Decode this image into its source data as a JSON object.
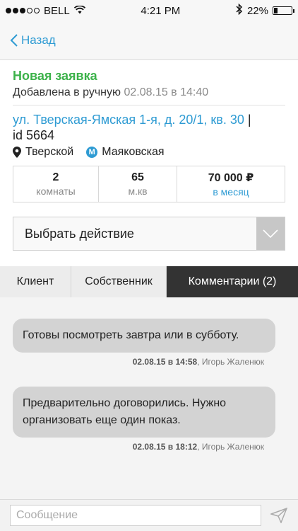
{
  "status_bar": {
    "signal_dots_filled": 3,
    "signal_dots_total": 5,
    "carrier": "BELL",
    "time": "4:21 PM",
    "battery": "22%",
    "battery_level": 0.22
  },
  "nav": {
    "back_label": "Назад"
  },
  "lead": {
    "status": "Новая заявка",
    "added_prefix": "Добавлена в ручную",
    "added_datetime": "02.08.15 в 14:40",
    "address": "ул. Тверская-Ямская 1-я, д. 20/1, кв. 30",
    "address_separator": "|",
    "id": "id 5664",
    "district": "Тверской",
    "metro_icon_letter": "М",
    "metro": "Маяковская"
  },
  "stats": [
    {
      "value": "2",
      "label": "комнаты"
    },
    {
      "value": "65",
      "label": "м.кв"
    },
    {
      "value": "70 000 ₽",
      "label": "в месяц"
    }
  ],
  "action_select": {
    "value": "Выбрать действие"
  },
  "tabs": [
    {
      "label": "Клиент"
    },
    {
      "label": "Собственник"
    },
    {
      "label": "Комментарии (2)"
    }
  ],
  "comments": [
    {
      "text": "Готовы посмотреть завтра или в субботу.",
      "datetime": "02.08.15 в 14:58",
      "author": "Игорь Жаленюк"
    },
    {
      "text": "Предварительно договорились. Нужно организовать еще один показ.",
      "datetime": "02.08.15 в 18:12",
      "author": "Игорь Жаленюк"
    }
  ],
  "composer": {
    "placeholder": "Сообщение"
  },
  "colors": {
    "accent": "#2e9bd3",
    "status_green": "#3cb24a",
    "tab_active": "#333333"
  }
}
